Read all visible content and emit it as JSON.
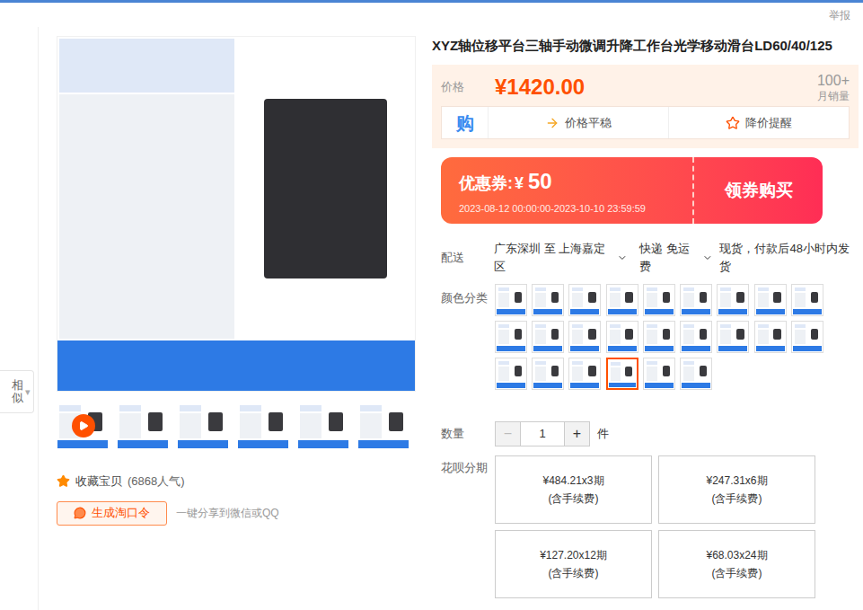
{
  "report": "举报",
  "side_tab": {
    "label": "相似",
    "arrow": "▾"
  },
  "gallery": {
    "thumbnails": [
      {
        "kind": "video",
        "selected": false
      },
      {
        "kind": "image",
        "selected": false
      },
      {
        "kind": "image",
        "selected": false
      },
      {
        "kind": "image",
        "selected": false
      },
      {
        "kind": "image",
        "selected": false
      },
      {
        "kind": "image",
        "selected": false
      }
    ]
  },
  "favorite": {
    "label": "收藏宝贝",
    "count": "(6868人气)"
  },
  "share": {
    "button": "生成淘口令",
    "hint": "一键分享到微信或QQ"
  },
  "title": "XYZ轴位移平台三轴手动微调升降工作台光学移动滑台LD60/40/125",
  "price": {
    "label": "价格",
    "value": "¥1420.00",
    "sales": "100+",
    "sales_label": "月销量",
    "badge": "购",
    "trend": "价格平稳",
    "alert": "降价提醒"
  },
  "coupon": {
    "label": "优惠券:",
    "currency": "¥",
    "amount": "50",
    "period": "2023-08-12 00:00:00-2023-10-10 23:59:59",
    "action": "领券购买"
  },
  "delivery": {
    "label": "配送",
    "route": "广东深圳 至 上海嘉定区",
    "shipping": "快递 免运费",
    "note": "现货，付款后48小时内发货"
  },
  "colors": {
    "label": "颜色分类",
    "items": [
      {
        "selected": false
      },
      {
        "selected": false
      },
      {
        "selected": false
      },
      {
        "selected": false
      },
      {
        "selected": false
      },
      {
        "selected": false
      },
      {
        "selected": false
      },
      {
        "selected": false
      },
      {
        "selected": false
      },
      {
        "selected": false
      },
      {
        "selected": false
      },
      {
        "selected": false
      },
      {
        "selected": false
      },
      {
        "selected": false
      },
      {
        "selected": false
      },
      {
        "selected": false
      },
      {
        "selected": false
      },
      {
        "selected": false
      },
      {
        "selected": false
      },
      {
        "selected": false
      },
      {
        "selected": false
      },
      {
        "selected": true
      },
      {
        "selected": false
      },
      {
        "selected": false
      }
    ]
  },
  "quantity": {
    "label": "数量",
    "minus": "−",
    "value": "1",
    "plus": "+",
    "unit": "件"
  },
  "installments": {
    "label": "花呗分期",
    "options": [
      {
        "amount": "¥484.21x3期",
        "fee": "(含手续费)"
      },
      {
        "amount": "¥247.31x6期",
        "fee": "(含手续费)"
      },
      {
        "amount": "¥127.20x12期",
        "fee": "(含手续费)"
      },
      {
        "amount": "¥68.03x24期",
        "fee": "(含手续费)"
      }
    ]
  }
}
